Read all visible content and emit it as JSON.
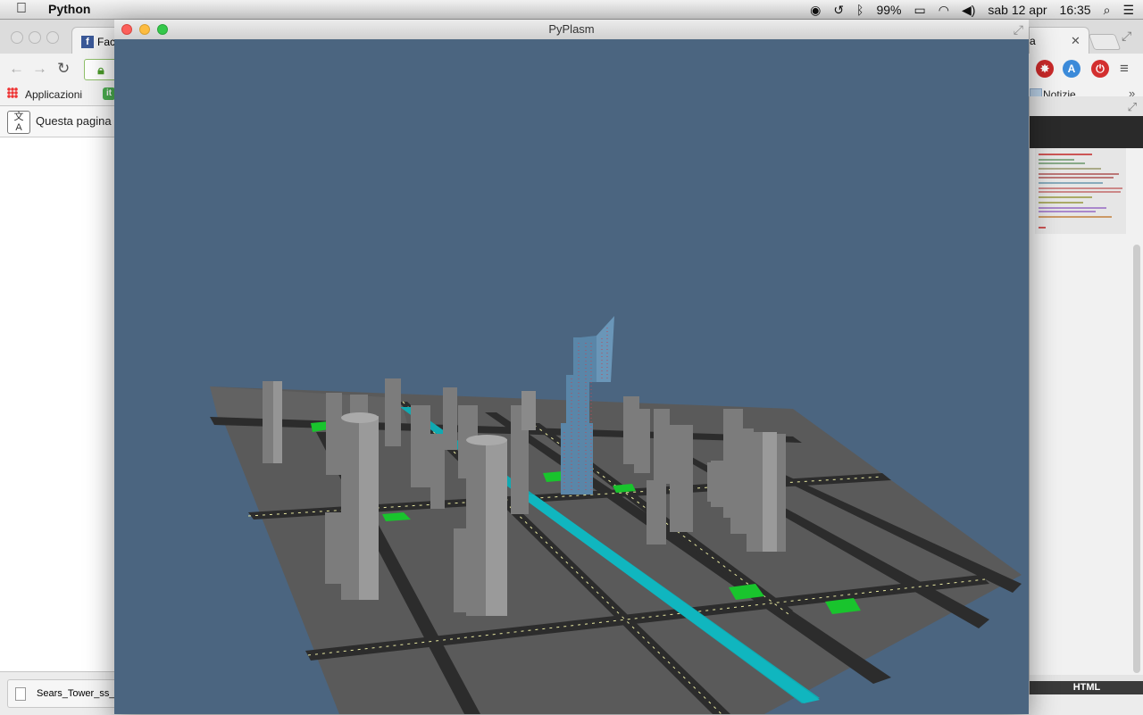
{
  "menubar": {
    "app_name": "Python",
    "battery": "99%",
    "date": "sab 12 apr",
    "time": "16:35"
  },
  "browser": {
    "tab_left_label": "Face",
    "tab_right_label": "a",
    "bookmarks": {
      "apps_label": "Applicazioni",
      "it_badge": "it",
      "notizie_label": "Notizie",
      "overflow": "»"
    },
    "translate_message": "Questa pagina",
    "download_name": "Sears_Tower_ss_"
  },
  "editor": {
    "footer_tab": "HTML"
  },
  "pyplasm": {
    "title": "PyPlasm"
  },
  "colors": {
    "sky": "#4b6580",
    "ground": "#5a5a5a",
    "road": "#2e2e2e",
    "river": "#12a5ad",
    "trees": "#18c22b",
    "towers": "#8a8a8a"
  }
}
